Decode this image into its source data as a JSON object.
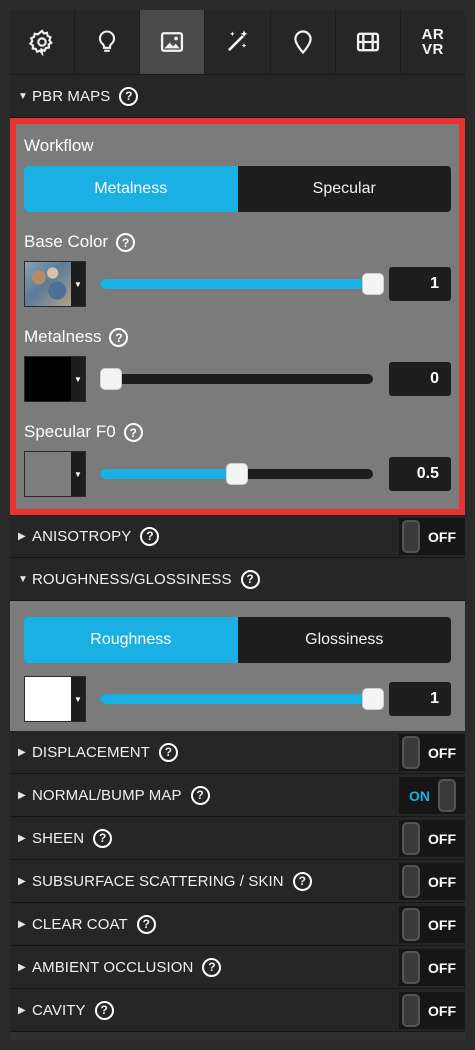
{
  "toolbar": {
    "tools": [
      {
        "icon": "gear-icon"
      },
      {
        "icon": "lightbulb-icon"
      },
      {
        "icon": "image-icon",
        "active": true
      },
      {
        "icon": "magic-wand-icon"
      },
      {
        "icon": "location-pin-icon"
      },
      {
        "icon": "film-icon"
      },
      {
        "icon": "ar-vr-icon",
        "label_top": "AR",
        "label_bottom": "VR"
      }
    ]
  },
  "pbr_maps": {
    "header": "PBR MAPS",
    "help": "?",
    "workflow_label": "Workflow",
    "workflow_options": [
      "Metalness",
      "Specular"
    ],
    "workflow_selected": "Metalness",
    "base_color": {
      "label": "Base Color",
      "value": "1",
      "level": 1.0
    },
    "metalness": {
      "label": "Metalness",
      "value": "0",
      "level": 0.0,
      "swatch_color": "#000000"
    },
    "specular_f0": {
      "label": "Specular F0",
      "value": "0.5",
      "level": 0.5,
      "swatch_color": "#7d7d7d"
    }
  },
  "anisotropy": {
    "header": "ANISOTROPY",
    "toggle": "OFF"
  },
  "roughness": {
    "header": "ROUGHNESS/GLOSSINESS",
    "options": [
      "Roughness",
      "Glossiness"
    ],
    "selected": "Roughness",
    "value": "1",
    "level": 1.0,
    "swatch_color": "#ffffff"
  },
  "sections": [
    {
      "name": "DISPLACEMENT",
      "toggle": "OFF"
    },
    {
      "name": "NORMAL/BUMP MAP",
      "toggle": "ON"
    },
    {
      "name": "SHEEN",
      "toggle": "OFF"
    },
    {
      "name": "SUBSURFACE SCATTERING / SKIN",
      "toggle": "OFF"
    },
    {
      "name": "CLEAR COAT",
      "toggle": "OFF"
    },
    {
      "name": "AMBIENT OCCLUSION",
      "toggle": "OFF"
    },
    {
      "name": "CAVITY",
      "toggle": "OFF"
    }
  ],
  "colors": {
    "accent": "#1bb0e4",
    "highlight_border": "#e8322f",
    "panel_bg": "#7b7b7b",
    "header_bg": "#262626"
  }
}
